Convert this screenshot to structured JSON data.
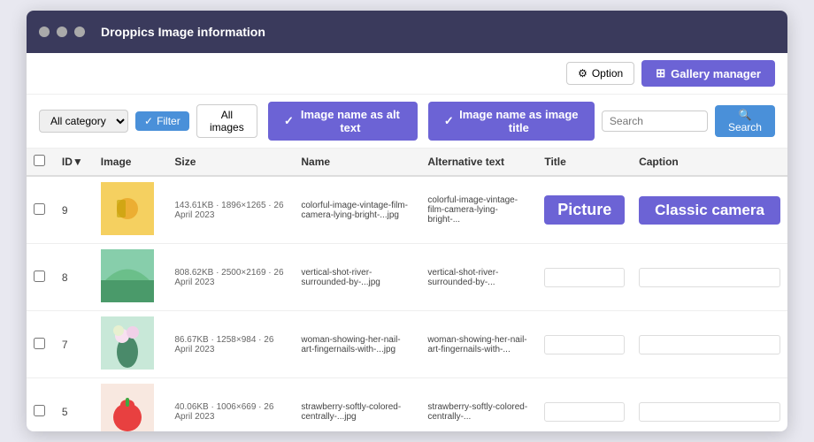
{
  "window": {
    "title": "Droppics Image information",
    "dots": [
      "dot1",
      "dot2",
      "dot3"
    ]
  },
  "header": {
    "option_label": "Option",
    "gallery_manager_label": "Gallery manager"
  },
  "toolbar": {
    "category_placeholder": "All category",
    "filter_label": "Filter",
    "all_images_label": "All images",
    "alt_text_tab": "Image name as alt text",
    "title_tab": "Image name as image title",
    "search_placeholder": "Search",
    "search_btn_label": "Search"
  },
  "table": {
    "headers": [
      "",
      "ID▼",
      "Image",
      "Size",
      "Name",
      "Alternative text",
      "Title",
      "Caption"
    ],
    "rows": [
      {
        "id": "9",
        "size": "143.61KB · 1896×1265 · 26 April 2023",
        "name": "colorful-image-vintage-film-camera-lying-bright-...jpg",
        "alt": "colorful-image-vintage-film-camera-lying-bright-...",
        "title": "Picture",
        "caption": "Classic camera",
        "img_color": "#f5e060",
        "img_type": "yellow"
      },
      {
        "id": "8",
        "size": "808.62KB · 2500×2169 · 26 April 2023",
        "name": "vertical-shot-river-surrounded-by-...jpg",
        "alt": "vertical-shot-river-surrounded-by-...",
        "title": "",
        "caption": "",
        "img_color": "#4a9a6a",
        "img_type": "green"
      },
      {
        "id": "7",
        "size": "86.67KB · 1258×984 · 26 April 2023",
        "name": "woman-showing-her-nail-art-fingernails-with-...jpg",
        "alt": "woman-showing-her-nail-art-fingernails-with-...",
        "title": "",
        "caption": "",
        "img_color": "#88c8a0",
        "img_type": "flower"
      },
      {
        "id": "5",
        "size": "40.06KB · 1006×669 · 26 April 2023",
        "name": "strawberry-softly-colored-centrally-...jpg",
        "alt": "strawberry-softly-colored-centrally-...",
        "title": "",
        "caption": "",
        "img_color": "#f08060",
        "img_type": "red"
      }
    ]
  }
}
